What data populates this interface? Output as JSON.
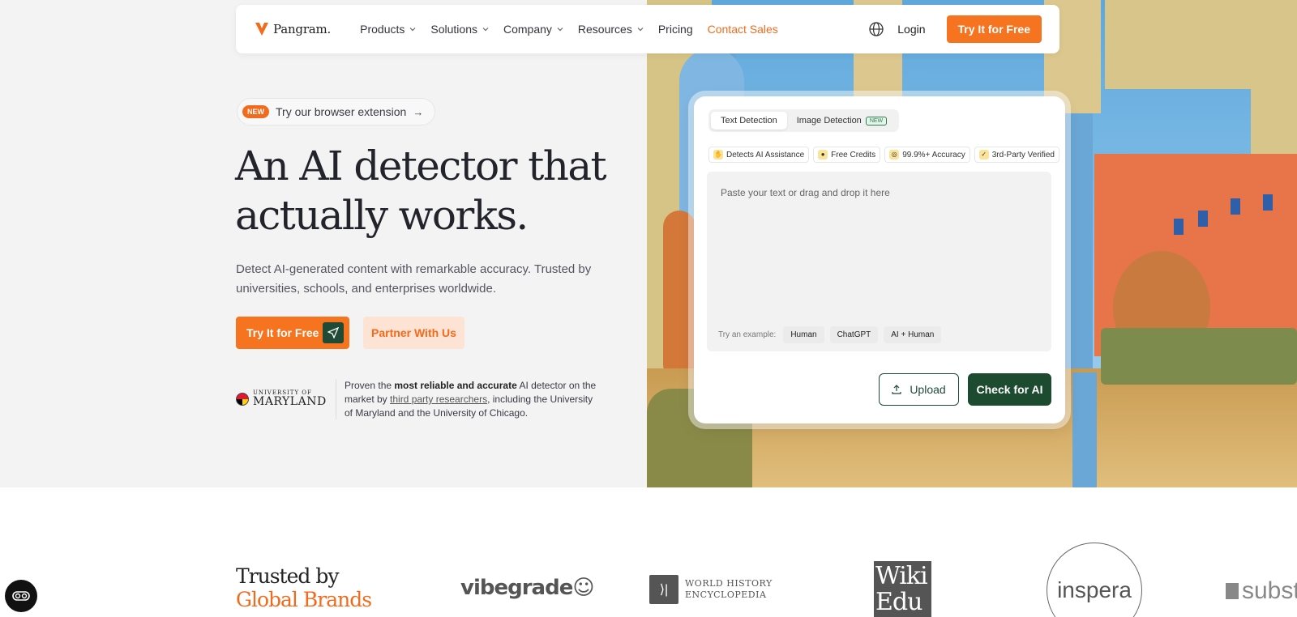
{
  "nav": {
    "brand": "Pangram.",
    "items": [
      {
        "label": "Products",
        "dropdown": true
      },
      {
        "label": "Solutions",
        "dropdown": true
      },
      {
        "label": "Company",
        "dropdown": true
      },
      {
        "label": "Resources",
        "dropdown": true
      },
      {
        "label": "Pricing",
        "dropdown": false
      },
      {
        "label": "Contact Sales",
        "dropdown": false,
        "accent": true
      }
    ],
    "login": "Login",
    "cta": "Try It for Free"
  },
  "hero": {
    "extension_badge": "NEW",
    "extension_text": "Try our browser extension",
    "extension_arrow": "→",
    "headline_line1": "An AI detector that",
    "headline_line2": "actually works.",
    "subtext": "Detect AI-generated content with remarkable accuracy. Trusted by universities, schools, and enterprises worldwide.",
    "primary_cta": "Try It for Free",
    "secondary_cta": "Partner With Us",
    "university_small": "UNIVERSITY OF",
    "university_big": "MARYLAND",
    "proof_prefix": "Proven the ",
    "proof_bold": "most reliable and accurate",
    "proof_mid": " AI detector on the market by ",
    "proof_link": "third party researchers",
    "proof_suffix": ", including the University of Maryland and the University of Chicago."
  },
  "detector": {
    "tabs": [
      {
        "label": "Text Detection",
        "active": true
      },
      {
        "label": "Image Detection",
        "active": false,
        "badge": "NEW"
      }
    ],
    "features": [
      {
        "label": "Detects AI Assistance",
        "icon": "hand-icon"
      },
      {
        "label": "Free Credits",
        "icon": "coins-icon"
      },
      {
        "label": "99.9%+ Accuracy",
        "icon": "target-icon"
      },
      {
        "label": "3rd-Party Verified",
        "icon": "check-icon"
      }
    ],
    "placeholder": "Paste your text or drag and drop it here",
    "example_label": "Try an example:",
    "examples": [
      "Human",
      "ChatGPT",
      "AI + Human"
    ],
    "upload_label": "Upload",
    "check_label": "Check for AI"
  },
  "trusted": {
    "line1": "Trusted by",
    "line2": "Global Brands",
    "brands": {
      "vibegrade": "vibegrade",
      "whe_line1": "WORLD HISTORY",
      "whe_line2": "ENCYCLOPEDIA",
      "wiki_line1": "Wiki",
      "wiki_line2": "Edu",
      "inspera": "inspera",
      "subst": "subst"
    }
  },
  "colors": {
    "accent": "#f6731f",
    "dark_green": "#1c4b30",
    "partner_bg": "#fde3d3"
  }
}
